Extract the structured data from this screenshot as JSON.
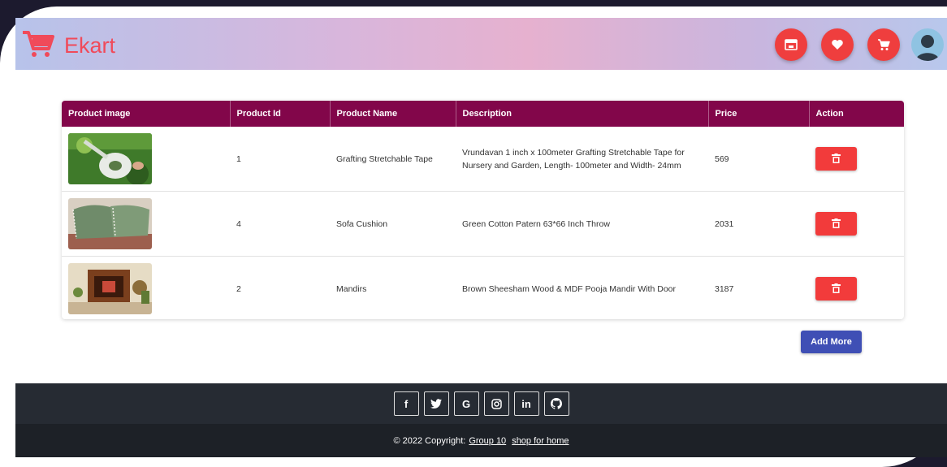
{
  "brand": {
    "name": "Ekart"
  },
  "nav": {
    "icons": [
      "store-icon",
      "heart-icon",
      "cart-icon",
      "user-avatar"
    ]
  },
  "table": {
    "headers": [
      "Product image",
      "Product Id",
      "Product Name",
      "Description",
      "Price",
      "Action"
    ],
    "rows": [
      {
        "id": "1",
        "name": "Grafting Stretchable Tape",
        "description": "Vrundavan 1 inch x 100meter Grafting Stretchable Tape for Nursery and Garden, Length- 100meter and Width- 24mm",
        "price": "569"
      },
      {
        "id": "4",
        "name": "Sofa Cushion",
        "description": "Green Cotton Patern 63*66 Inch Throw",
        "price": "2031"
      },
      {
        "id": "2",
        "name": "Mandirs",
        "description": "Brown Sheesham Wood & MDF Pooja Mandir With Door",
        "price": "3187"
      }
    ]
  },
  "actions": {
    "add_more": "Add More"
  },
  "footer": {
    "social": [
      "f",
      "twitter",
      "G",
      "instagram",
      "in",
      "github"
    ],
    "copyright": "© 2022 Copyright:",
    "link1": "Group 10",
    "link2": "shop for home"
  },
  "colors": {
    "brand_red": "#f04a5a",
    "header_maroon": "#82064a",
    "delete_red": "#f23b3b",
    "add_more_blue": "#3f4fb5",
    "footer_dark": "#262b33"
  }
}
